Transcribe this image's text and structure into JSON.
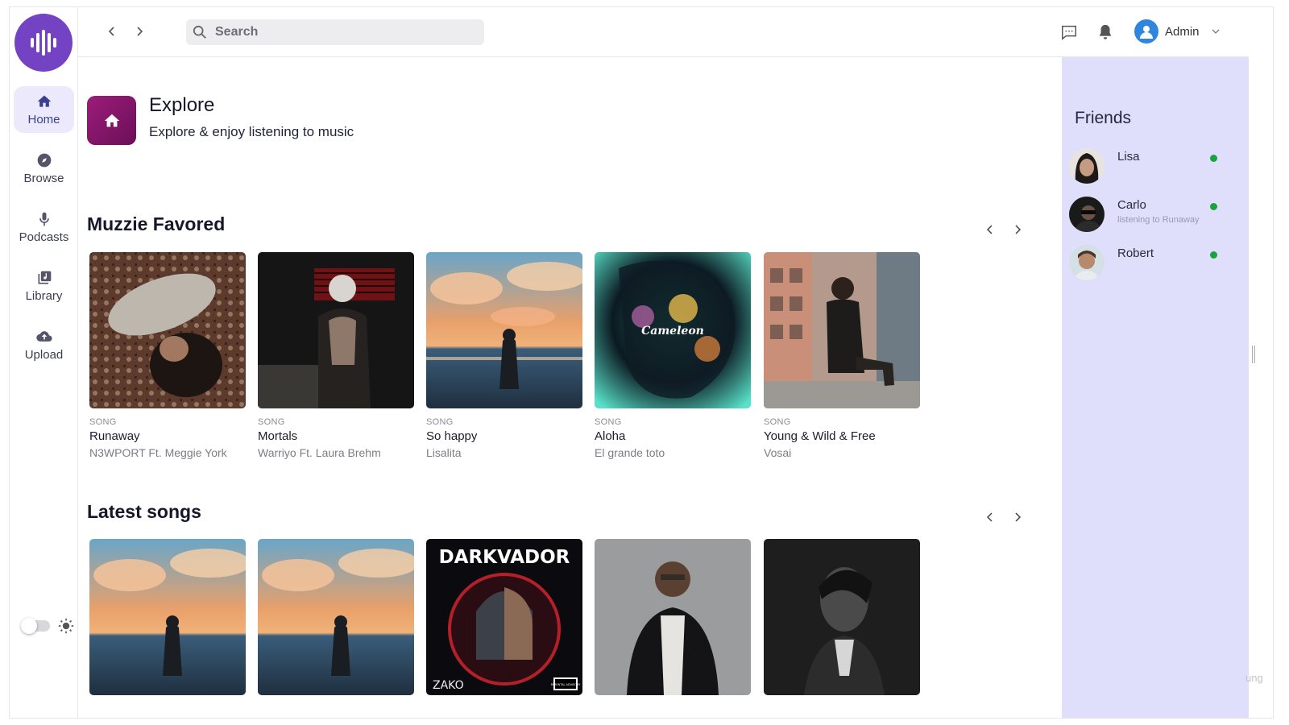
{
  "sidebar": {
    "items": [
      {
        "label": "Home",
        "icon": "home-icon"
      },
      {
        "label": "Browse",
        "icon": "compass-icon"
      },
      {
        "label": "Podcasts",
        "icon": "microphone-icon"
      },
      {
        "label": "Library",
        "icon": "library-icon"
      },
      {
        "label": "Upload",
        "icon": "cloud-upload-icon"
      }
    ],
    "active_index": 0,
    "theme": "light"
  },
  "topbar": {
    "search_placeholder": "Search",
    "user_name": "Admin"
  },
  "explore": {
    "title": "Explore",
    "subtitle": "Explore & enjoy listening to music"
  },
  "favored": {
    "title": "Muzzie Favored",
    "cards": [
      {
        "type": "SONG",
        "title": "Runaway",
        "artist": "N3WPORT Ft. Meggie York"
      },
      {
        "type": "SONG",
        "title": "Mortals",
        "artist": "Warriyo Ft. Laura Brehm"
      },
      {
        "type": "SONG",
        "title": "So happy",
        "artist": "Lisalita"
      },
      {
        "type": "SONG",
        "title": "Aloha",
        "artist": "El grande toto"
      },
      {
        "type": "SONG",
        "title": "Young & Wild & Free",
        "artist": "Vosai"
      }
    ],
    "cover_texts": {
      "aloha": "Cameleon"
    }
  },
  "latest": {
    "title": "Latest songs",
    "cover_texts": {
      "darkvador_title": "DARKVADOR",
      "darkvador_artist": "ZAKO",
      "advisory": "PARENTAL ADVISORY"
    }
  },
  "friends": {
    "title": "Friends",
    "list": [
      {
        "name": "Lisa",
        "status": "",
        "online": true
      },
      {
        "name": "Carlo",
        "status": "listening to Runaway",
        "online": true
      },
      {
        "name": "Robert",
        "status": "",
        "online": true
      }
    ]
  },
  "misc": {
    "corner_text": "ung"
  },
  "colors": {
    "accent": "#7443c4",
    "active_nav_bg": "#ebe9fb",
    "friends_bg": "#dfdffb",
    "online": "#1aa33b"
  }
}
